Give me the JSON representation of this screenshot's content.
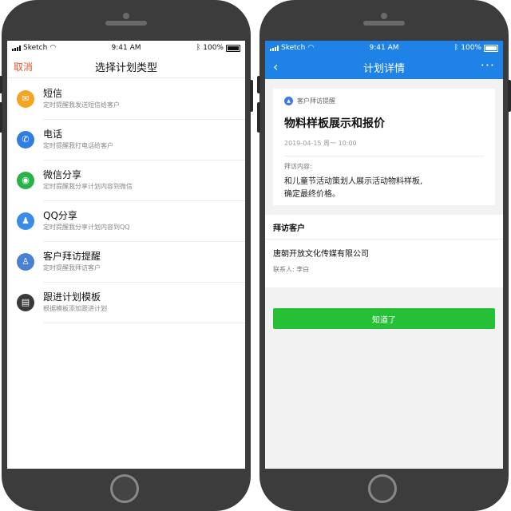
{
  "left": {
    "status": {
      "carrier": "Sketch",
      "time": "9:41 AM",
      "battery": "100%"
    },
    "nav": {
      "cancel": "取消",
      "title": "选择计划类型"
    },
    "items": [
      {
        "title": "短信",
        "subtitle": "定时提醒我发送短信给客户",
        "icon": "message-icon",
        "color": "#f5a524",
        "glyph": "✉"
      },
      {
        "title": "电话",
        "subtitle": "定时提醒我打电话给客户",
        "icon": "phone-icon",
        "color": "#2f7fe0",
        "glyph": "✆"
      },
      {
        "title": "微信分享",
        "subtitle": "定时提醒我分享计划内容到微信",
        "icon": "wechat-icon",
        "color": "#27b24a",
        "glyph": "◉"
      },
      {
        "title": "QQ分享",
        "subtitle": "定时提醒我分享计划内容到QQ",
        "icon": "qq-icon",
        "color": "#3b8be8",
        "glyph": "♟"
      },
      {
        "title": "客户拜访提醒",
        "subtitle": "定时提醒我拜访客户",
        "icon": "visit-icon",
        "color": "#4a7fd6",
        "glyph": "♙"
      },
      {
        "title": "跟进计划模板",
        "subtitle": "根据模板添加跟进计划",
        "icon": "template-icon",
        "color": "#3a3a3a",
        "glyph": "▤"
      }
    ]
  },
  "right": {
    "status": {
      "carrier": "Sketch",
      "time": "9:41 AM",
      "battery": "100%"
    },
    "nav": {
      "back": "‹",
      "title": "计划详情",
      "more": "···"
    },
    "card": {
      "tag": "客户拜访提醒",
      "title": "物料样板展示和报价",
      "date": "2019-04-15 周一 10:00",
      "content_label": "拜访内容:",
      "content_line1": "和儿童节活动策划人展示活动物料样板,",
      "content_line2": "确定最终价格。"
    },
    "customer": {
      "heading": "拜访客户",
      "company": "唐朝开放文化传媒有限公司",
      "contact": "联系人: 李白"
    },
    "button": "知道了"
  },
  "colors": {
    "accent_blue": "#1e82e6",
    "cancel_orange": "#e2572f",
    "confirm_green": "#25c035"
  }
}
